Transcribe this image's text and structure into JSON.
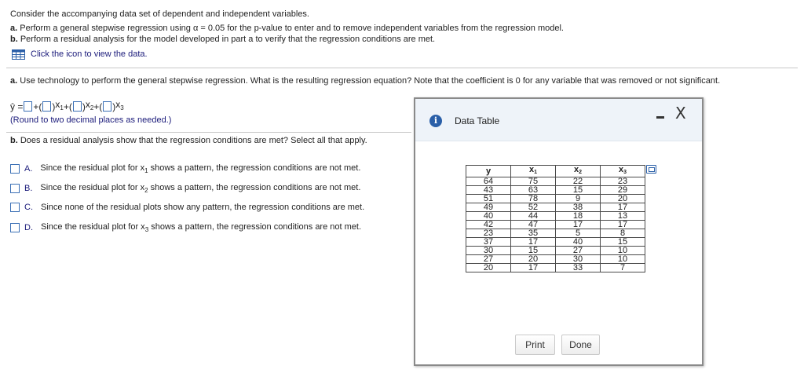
{
  "intro": {
    "line1": "Consider the accompanying data set of dependent and independent variables.",
    "part_a_prefix": "a.",
    "part_a_text": " Perform a general stepwise regression using α = 0.05 for the p-value to enter and to remove independent variables from the regression model.",
    "part_b_prefix": "b.",
    "part_b_text": " Perform a residual analysis for the model developed in part a to verify that the regression conditions are met.",
    "data_link": "Click the icon to view the data."
  },
  "question_a": {
    "label": "a.",
    "text": " Use technology to perform the general stepwise regression. What is the resulting regression equation? Note that the coefficient is 0 for any variable that was removed or not significant.",
    "equation": {
      "lhs": "ŷ =",
      "plus": "+",
      "x1": "x",
      "x1_sub": "1",
      "x2": "x",
      "x2_sub": "2",
      "x3": "x",
      "x3_sub": "3"
    },
    "round_note": "(Round to two decimal places as needed.)"
  },
  "question_b": {
    "label": "b.",
    "text": " Does a residual analysis show that the regression conditions are met? Select all that apply."
  },
  "options": [
    {
      "letter": "A.",
      "pre": "Since the residual plot for x",
      "sub": "1",
      "post": " shows a pattern, the regression conditions are not met."
    },
    {
      "letter": "B.",
      "pre": "Since the residual plot for x",
      "sub": "2",
      "post": " shows a pattern, the regression conditions are not met."
    },
    {
      "letter": "C.",
      "pre": "Since none of the residual plots show any pattern, the regression conditions are met.",
      "sub": "",
      "post": ""
    },
    {
      "letter": "D.",
      "pre": "Since the residual plot for x",
      "sub": "3",
      "post": " shows a pattern, the regression conditions are not met."
    }
  ],
  "dialog": {
    "title": "Data Table",
    "info_icon": "i",
    "close_glyph": "X",
    "headers": [
      {
        "main": "y",
        "sub": ""
      },
      {
        "main": "x",
        "sub": "1"
      },
      {
        "main": "x",
        "sub": "2"
      },
      {
        "main": "x",
        "sub": "3"
      }
    ],
    "rows": [
      [
        "64",
        "75",
        "22",
        "23"
      ],
      [
        "43",
        "63",
        "15",
        "29"
      ],
      [
        "51",
        "78",
        "9",
        "20"
      ],
      [
        "49",
        "52",
        "38",
        "17"
      ],
      [
        "40",
        "44",
        "18",
        "13"
      ],
      [
        "42",
        "47",
        "17",
        "17"
      ],
      [
        "23",
        "35",
        "5",
        "8"
      ],
      [
        "37",
        "17",
        "40",
        "15"
      ],
      [
        "30",
        "15",
        "27",
        "10"
      ],
      [
        "27",
        "20",
        "30",
        "10"
      ],
      [
        "20",
        "17",
        "33",
        "7"
      ]
    ],
    "print_label": "Print",
    "done_label": "Done"
  },
  "colors": {
    "accent": "#2a5fa8",
    "link_text": "#1a1a7a",
    "dialog_header_bg": "#eef3f9"
  }
}
